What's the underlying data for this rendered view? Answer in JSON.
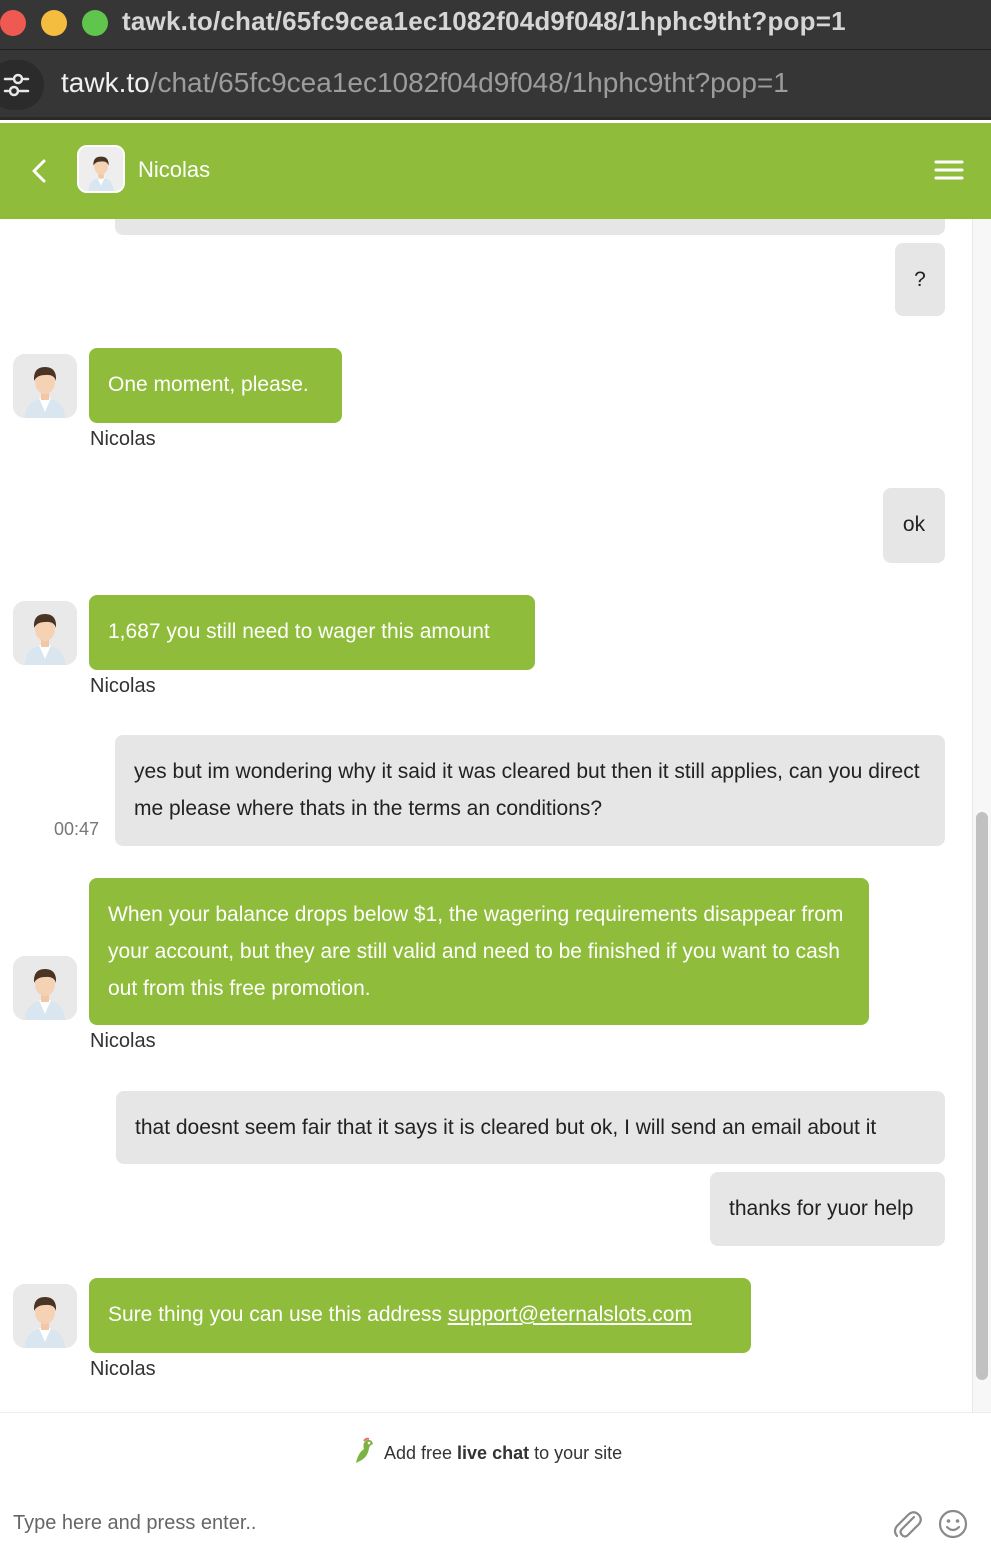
{
  "window": {
    "title": "tawk.to/chat/65fc9cea1ec1082f04d9f048/1hphc9tht?pop=1"
  },
  "address_bar": {
    "host": "tawk.to",
    "path": "/chat/65fc9cea1ec1082f04d9f048/1hphc9tht?pop=1"
  },
  "header": {
    "agent_name": "Nicolas",
    "accent_color": "#8fbd3b"
  },
  "messages": [
    {
      "from": "visitor",
      "text": "?"
    },
    {
      "from": "agent",
      "text": "One moment, please.",
      "sender": "Nicolas"
    },
    {
      "from": "visitor",
      "text": "ok"
    },
    {
      "from": "agent",
      "text": "1,687 you still need to wager this amount",
      "sender": "Nicolas"
    },
    {
      "from": "visitor",
      "text": "yes but im wondering why it said it was cleared but then it still applies, can you direct me please where thats in the terms an conditions?",
      "time": "00:47"
    },
    {
      "from": "agent",
      "text": "When your balance drops below $1, the wagering requirements disappear from your account, but they are still valid and need to be finished if you want to cash out from this free promotion.",
      "sender": "Nicolas"
    },
    {
      "from": "visitor",
      "text": "that doesnt seem fair that it says it is cleared but ok, I will send an email about it"
    },
    {
      "from": "visitor",
      "text": "thanks for yuor help"
    },
    {
      "from": "agent",
      "text_before": "Sure thing you can use this address ",
      "link": "support@eternalslots.com",
      "sender": "Nicolas"
    }
  ],
  "branding": {
    "part1": "Add free ",
    "bold": "live chat",
    "part2": " to your site"
  },
  "composer": {
    "placeholder": "Type here and press enter.."
  },
  "icons": [
    "site-settings-icon",
    "back-chevron-icon",
    "hamburger-menu-icon",
    "agent-avatar",
    "tawk-bird-logo",
    "paperclip-icon",
    "smiley-icon"
  ]
}
